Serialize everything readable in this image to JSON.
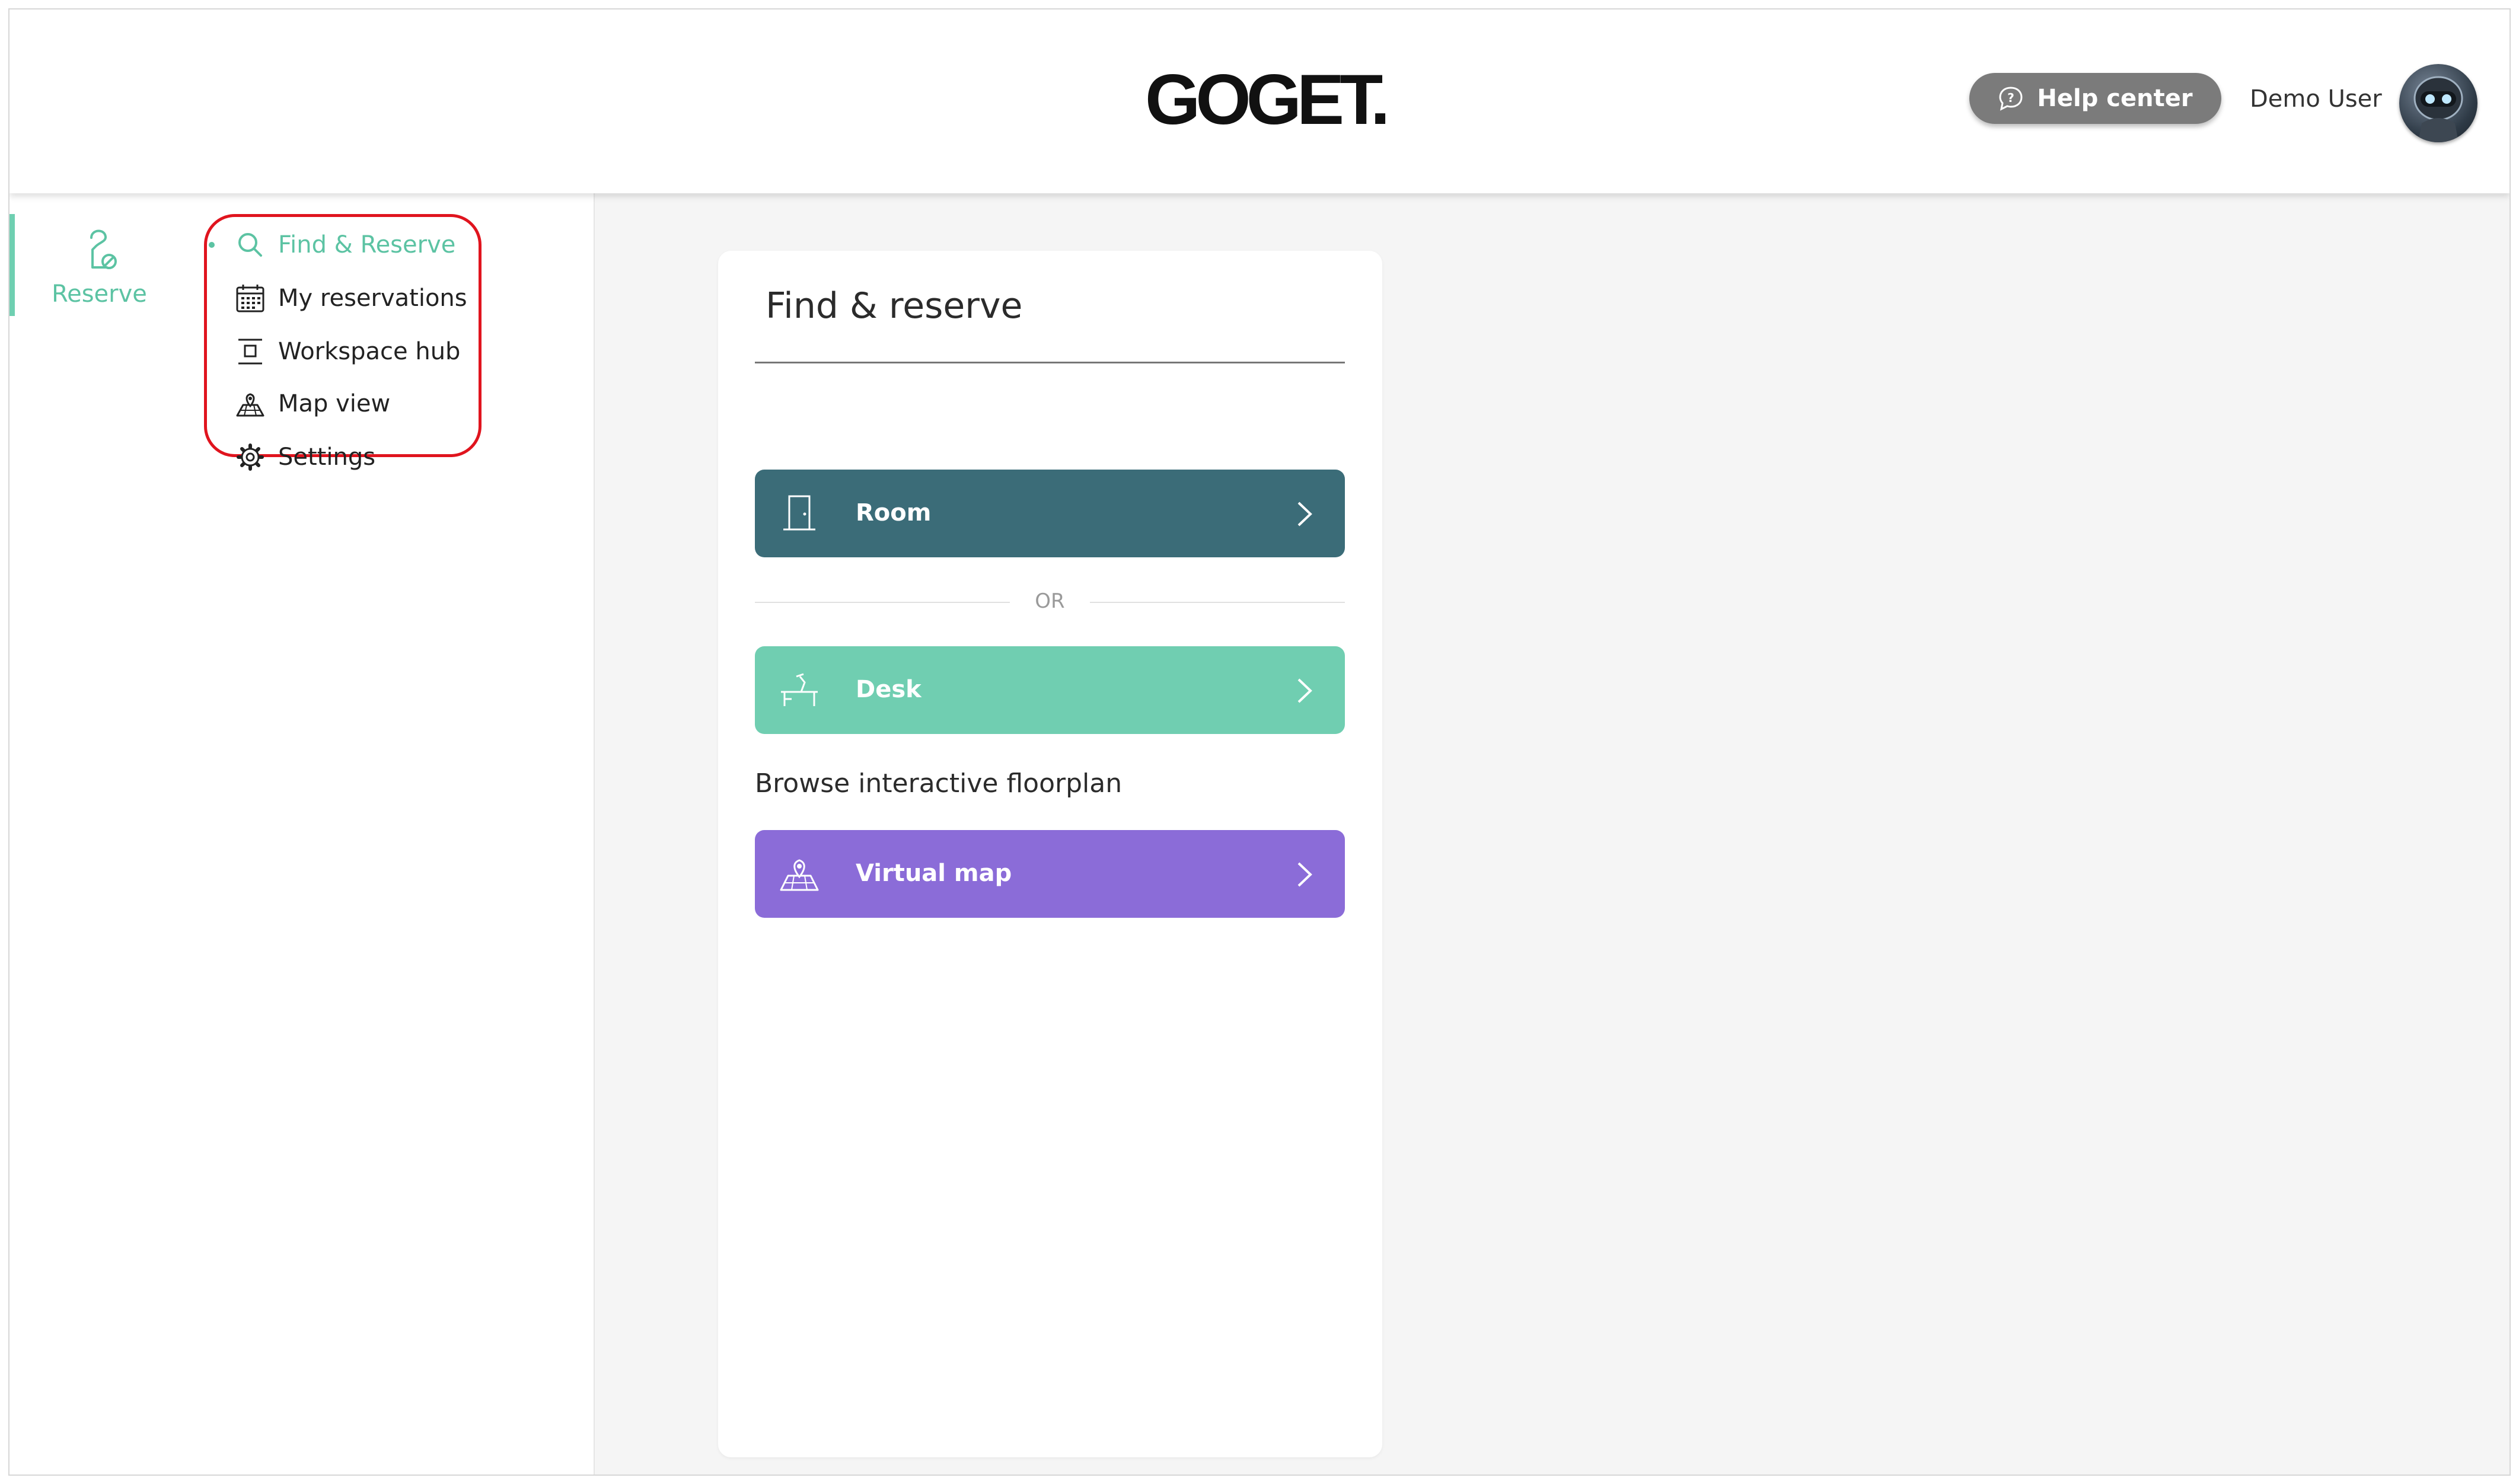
{
  "header": {
    "logo_text": "GOGET.",
    "help_label": "Help center",
    "user_name": "Demo User"
  },
  "rail": {
    "items": [
      {
        "label": "Reserve",
        "icon": "door-hanger-icon",
        "active": true
      }
    ]
  },
  "submenu": {
    "items": [
      {
        "label": "Find & Reserve",
        "icon": "search-icon",
        "active": true
      },
      {
        "label": "My reservations",
        "icon": "calendar-icon",
        "active": false
      },
      {
        "label": "Workspace hub",
        "icon": "workspace-icon",
        "active": false
      },
      {
        "label": "Map view",
        "icon": "map-icon",
        "active": false
      },
      {
        "label": "Settings",
        "icon": "gear-icon",
        "active": false
      }
    ]
  },
  "main": {
    "title": "Find & reserve",
    "room_label": "Room",
    "or_label": "OR",
    "desk_label": "Desk",
    "browse_label": "Browse interactive floorplan",
    "virtual_map_label": "Virtual map"
  },
  "colors": {
    "accent_green": "#5cc3a3",
    "room_button": "#3b6c78",
    "desk_button": "#70ceb1",
    "map_button": "#8b6cd8",
    "highlight": "#e0141e"
  }
}
